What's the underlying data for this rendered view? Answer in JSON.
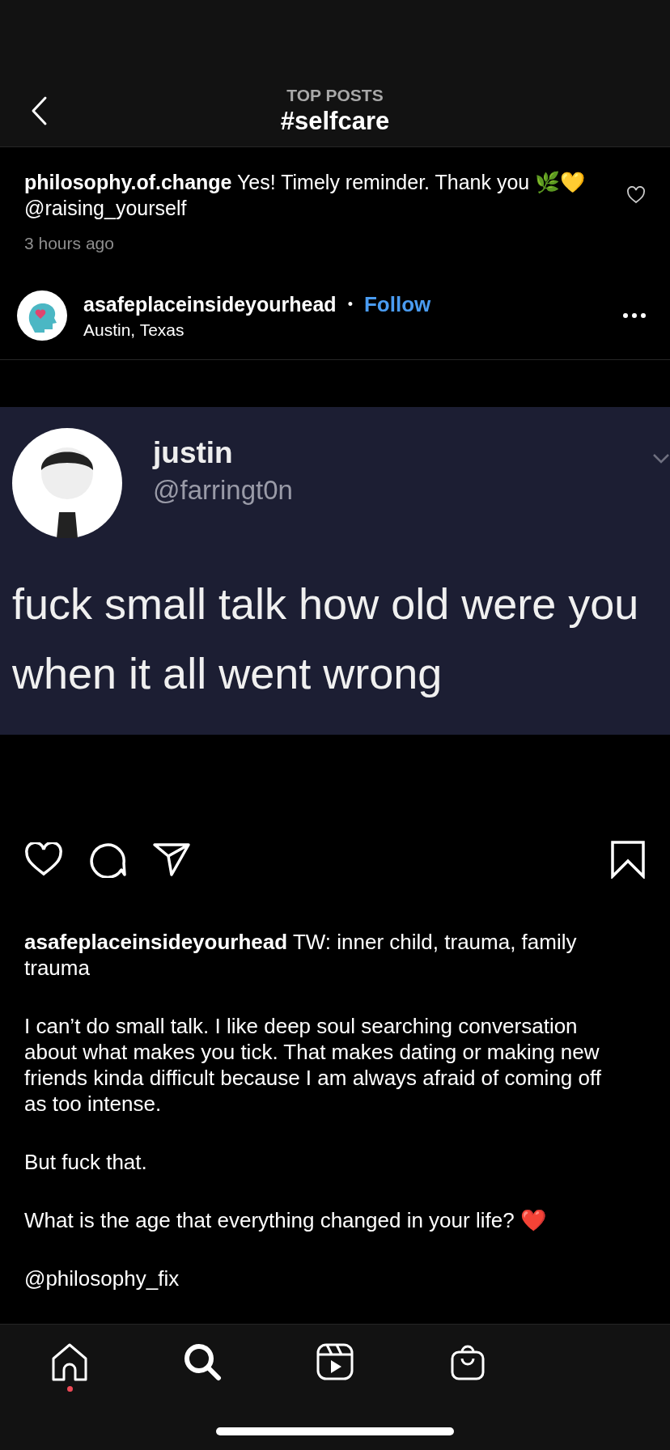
{
  "header": {
    "subtitle": "TOP POSTS",
    "title": "#selfcare"
  },
  "comment": {
    "username": "philosophy.of.change",
    "text": "Yes! Timely reminder. Thank you 🌿💛 @raising_yourself",
    "time": "3 hours ago",
    "liked": false
  },
  "post": {
    "username": "asafeplaceinsideyourhead",
    "separator": "•",
    "follow": "Follow",
    "location": "Austin, Texas",
    "tweet": {
      "name": "justin",
      "handle": "@farringt0n",
      "lines": [
        "fuck small talk how old were you",
        "when it all went wrong"
      ]
    },
    "liked": false,
    "saved": false,
    "caption": {
      "username": "asafeplaceinsideyourhead",
      "first": "TW: inner child, trauma, family trauma",
      "paragraphs": [
        "I can’t do small talk.  I like deep soul searching conversation about what makes you tick.  That makes dating or making new friends kinda difficult because I am always afraid of coming off as too intense.",
        "But fuck that.",
        "What is the age that everything changed in your life? ❤️",
        "@philosophy_fix"
      ]
    }
  },
  "nav": [
    {
      "kind": "home",
      "selected": false,
      "notification": true
    },
    {
      "kind": "search",
      "selected": true,
      "notification": false
    },
    {
      "kind": "reels",
      "selected": false,
      "notification": false
    },
    {
      "kind": "shop",
      "selected": false,
      "notification": false
    }
  ]
}
